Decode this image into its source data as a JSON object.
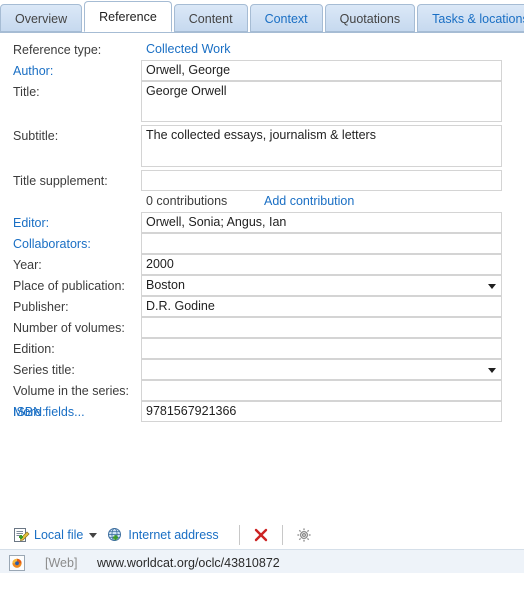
{
  "tabs": [
    {
      "label": "Overview",
      "state": "normal"
    },
    {
      "label": "Reference",
      "state": "active"
    },
    {
      "label": "Content",
      "state": "normal"
    },
    {
      "label": "Context",
      "state": "link"
    },
    {
      "label": "Quotations",
      "state": "normal"
    },
    {
      "label": "Tasks & locations",
      "state": "link"
    }
  ],
  "form": {
    "reference_type_label": "Reference type:",
    "reference_type_value": "Collected Work",
    "author_label": "Author:",
    "author_value": "Orwell, George",
    "title_label": "Title:",
    "title_value": "George Orwell",
    "subtitle_label": "Subtitle:",
    "subtitle_value": "The collected essays, journalism & letters",
    "title_supplement_label": "Title supplement:",
    "title_supplement_value": "",
    "contributions_count": "0 contributions",
    "add_contribution_label": "Add contribution",
    "editor_label": "Editor:",
    "editor_value": "Orwell, Sonia; Angus, Ian",
    "collaborators_label": "Collaborators:",
    "collaborators_value": "",
    "year_label": "Year:",
    "year_value": "2000",
    "place_label": "Place of publication:",
    "place_value": "Boston",
    "publisher_label": "Publisher:",
    "publisher_value": "D.R. Godine",
    "volumes_label": "Number of volumes:",
    "volumes_value": "",
    "edition_label": "Edition:",
    "edition_value": "",
    "series_title_label": "Series title:",
    "series_title_value": "",
    "volume_in_series_label": "Volume in the series:",
    "volume_in_series_value": "",
    "isbn_label": "ISBN:",
    "isbn_value": "9781567921366",
    "more_fields_label": "More fields..."
  },
  "toolbar": {
    "local_file_label": "Local file",
    "internet_address_label": "Internet address"
  },
  "attachment": {
    "kind": "[Web]",
    "url": "www.worldcat.org/oclc/43810872"
  },
  "colors": {
    "link": "#1a6fc4",
    "tab_bg": "#c6d9ef",
    "tab_border": "#a6bcd4",
    "field_border": "#d4d4d4",
    "attach_bg": "#eef3f9",
    "delete_red": "#cc2222",
    "plus_green": "#3c9a28"
  }
}
